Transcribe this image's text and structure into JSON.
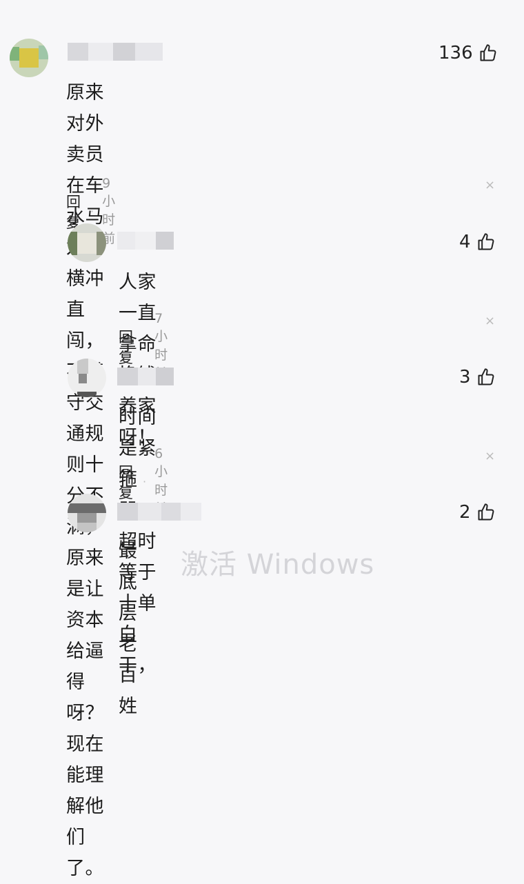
{
  "comments": [
    {
      "likes": "136",
      "text_lines": [
        "原来对外卖员在车水马龙中横冲直闯，不遵守交通规",
        "则十分不满，原来是让资本给逼得呀？现在能理解他",
        "们了。"
      ],
      "reply_label": "回复",
      "time": "9小时前"
    },
    {
      "likes": "4",
      "text_lines": [
        "人家一直拿命换钱养家呀！"
      ],
      "reply_label": "回复",
      "time": "7小时前"
    },
    {
      "likes": "3",
      "text_lines": [
        "时间是紧箍咒，超时等于十单白干，"
      ],
      "reply_label": "回复",
      "time": "6小时前"
    },
    {
      "likes": "2",
      "text_lines": [
        "最底层老百姓"
      ]
    }
  ],
  "separator": "·",
  "close_glyph": "×",
  "watermark": "激活 Windows",
  "icons": {
    "like": "thumbs-up-icon",
    "close": "close-icon"
  },
  "colors": {
    "background": "#f7f7f9",
    "time": "#999999",
    "close": "#bbbbbb"
  }
}
